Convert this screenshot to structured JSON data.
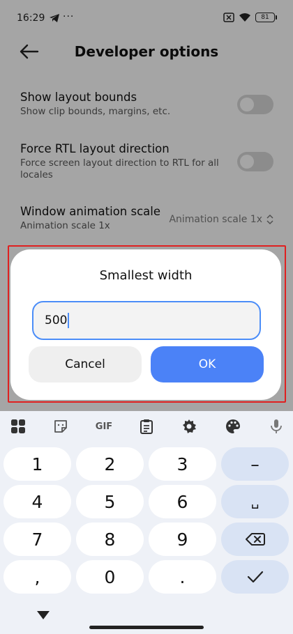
{
  "status_bar": {
    "time": "16:29",
    "dots": "···",
    "battery": "81"
  },
  "app_bar": {
    "title": "Developer options"
  },
  "settings": [
    {
      "title": "Show layout bounds",
      "subtitle": "Show clip bounds, margins, etc."
    },
    {
      "title": "Force RTL layout direction",
      "subtitle": "Force screen layout direction to RTL for all locales"
    },
    {
      "title": "Window animation scale",
      "subtitle": "Animation scale 1x",
      "value": "Animation scale 1x"
    }
  ],
  "dialog": {
    "title": "Smallest width",
    "input_value": "500",
    "cancel_label": "Cancel",
    "ok_label": "OK"
  },
  "keyboard": {
    "toolbar": {
      "gif_label": "GIF"
    },
    "rows": [
      [
        "1",
        "2",
        "3",
        "–"
      ],
      [
        "4",
        "5",
        "6",
        "␣"
      ],
      [
        "7",
        "8",
        "9",
        "⌫"
      ],
      [
        ",",
        "0",
        ".",
        "✓"
      ]
    ]
  },
  "colors": {
    "accent": "#4b82f7",
    "highlight": "#e02020"
  }
}
